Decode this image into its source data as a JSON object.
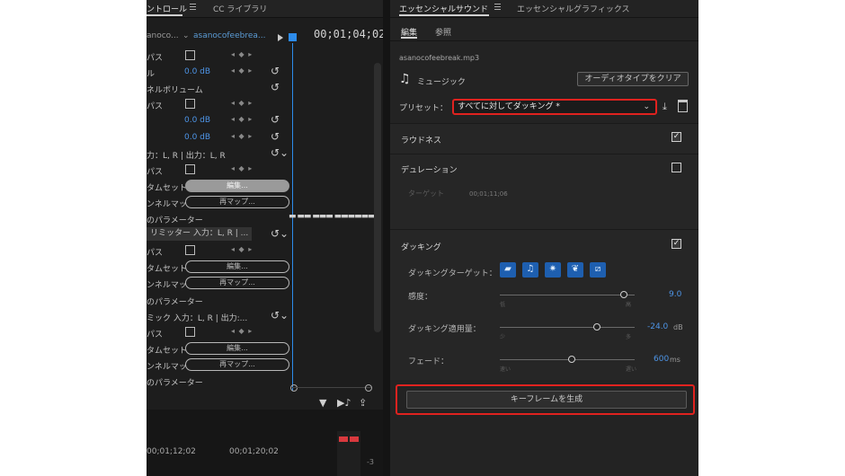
{
  "left_panel": {
    "tabs": [
      {
        "label": "ントロール",
        "active": true
      },
      {
        "label": "CC ライブラリ",
        "active": false
      }
    ],
    "clip": {
      "source": "anoco...",
      "sequence": "asanocofeebrea..."
    },
    "timecode": "00;01;04;02",
    "rows": [
      {
        "label": "パス",
        "type": "checkbox"
      },
      {
        "label": "ル",
        "value": "0.0 dB",
        "type": "value"
      },
      {
        "label": "ネルボリューム",
        "type": "header"
      },
      {
        "label": "パス",
        "type": "checkbox"
      },
      {
        "label": "",
        "value": "0.0 dB",
        "type": "value"
      },
      {
        "label": "",
        "value": "0.0 dB",
        "type": "value"
      },
      {
        "label": "力：L, R | 出力：L, R",
        "type": "header"
      },
      {
        "label": "パス",
        "type": "checkbox"
      },
      {
        "label": "タムセット",
        "button": "編集...",
        "type": "pill-filled"
      },
      {
        "label": "ンネルマッ",
        "button": "再マップ...",
        "type": "pill"
      },
      {
        "label": "のパラメーター",
        "type": "header"
      },
      {
        "label": "リミッター 入力：L, R | ...",
        "type": "boxed"
      },
      {
        "label": "パス",
        "type": "checkbox"
      },
      {
        "label": "タムセット",
        "button": "編集...",
        "type": "pill"
      },
      {
        "label": "ンネルマッ",
        "button": "再マップ...",
        "type": "pill"
      },
      {
        "label": "のパラメーター",
        "type": "header"
      },
      {
        "label": "ミック 入力：L, R | 出力:...",
        "type": "header"
      },
      {
        "label": "パス",
        "type": "checkbox"
      },
      {
        "label": "タムセット",
        "button": "編集...",
        "type": "pill"
      },
      {
        "label": "ンネルマッ",
        "button": "再マップ...",
        "type": "pill"
      },
      {
        "label": "のパラメーター",
        "type": "header"
      }
    ],
    "ruler": [
      "00;01;12;02",
      "00;01;20;02"
    ],
    "meter_label": "-3"
  },
  "right_panel": {
    "tabs": [
      {
        "label": "エッセンシャルサウンド",
        "active": true
      },
      {
        "label": "エッセンシャルグラフィックス",
        "active": false
      }
    ],
    "subtabs": [
      {
        "label": "編集",
        "active": true
      },
      {
        "label": "参照",
        "active": false
      }
    ],
    "filename": "asanocofeebreak.mp3",
    "audio_type": "ミュージック",
    "clear_button": "オーディオタイプをクリア",
    "preset_label": "プリセット：",
    "preset_value": "すべてに対してダッキング *",
    "loudness": {
      "title": "ラウドネス",
      "checked": true
    },
    "duration": {
      "title": "デュレーション",
      "checked": false,
      "target_label": "ターゲット",
      "target_time": "00;01;11;06"
    },
    "ducking": {
      "title": "ダッキング",
      "checked": true,
      "target_label": "ダッキングターゲット：",
      "target_icons": [
        "dialogue-icon",
        "music-icon",
        "sfx-icon",
        "ambience-icon",
        "unclassified-icon"
      ],
      "sliders": [
        {
          "label": "感度：",
          "value": "9.0",
          "unit": "",
          "min_label": "低",
          "max_label": "高",
          "fraction": 0.92
        },
        {
          "label": "ダッキング適用量：",
          "value": "-24.0",
          "unit": "dB",
          "min_label": "少",
          "max_label": "多",
          "fraction": 0.72
        },
        {
          "label": "フェード：",
          "value": "600",
          "unit": "ms",
          "min_label": "速い",
          "max_label": "遅い",
          "fraction": 0.53
        }
      ]
    },
    "generate_button": "キーフレームを生成"
  },
  "colors": {
    "highlight": "#e0221f",
    "accent_blue": "#2d8ceb",
    "value_blue": "#4d94e6"
  }
}
